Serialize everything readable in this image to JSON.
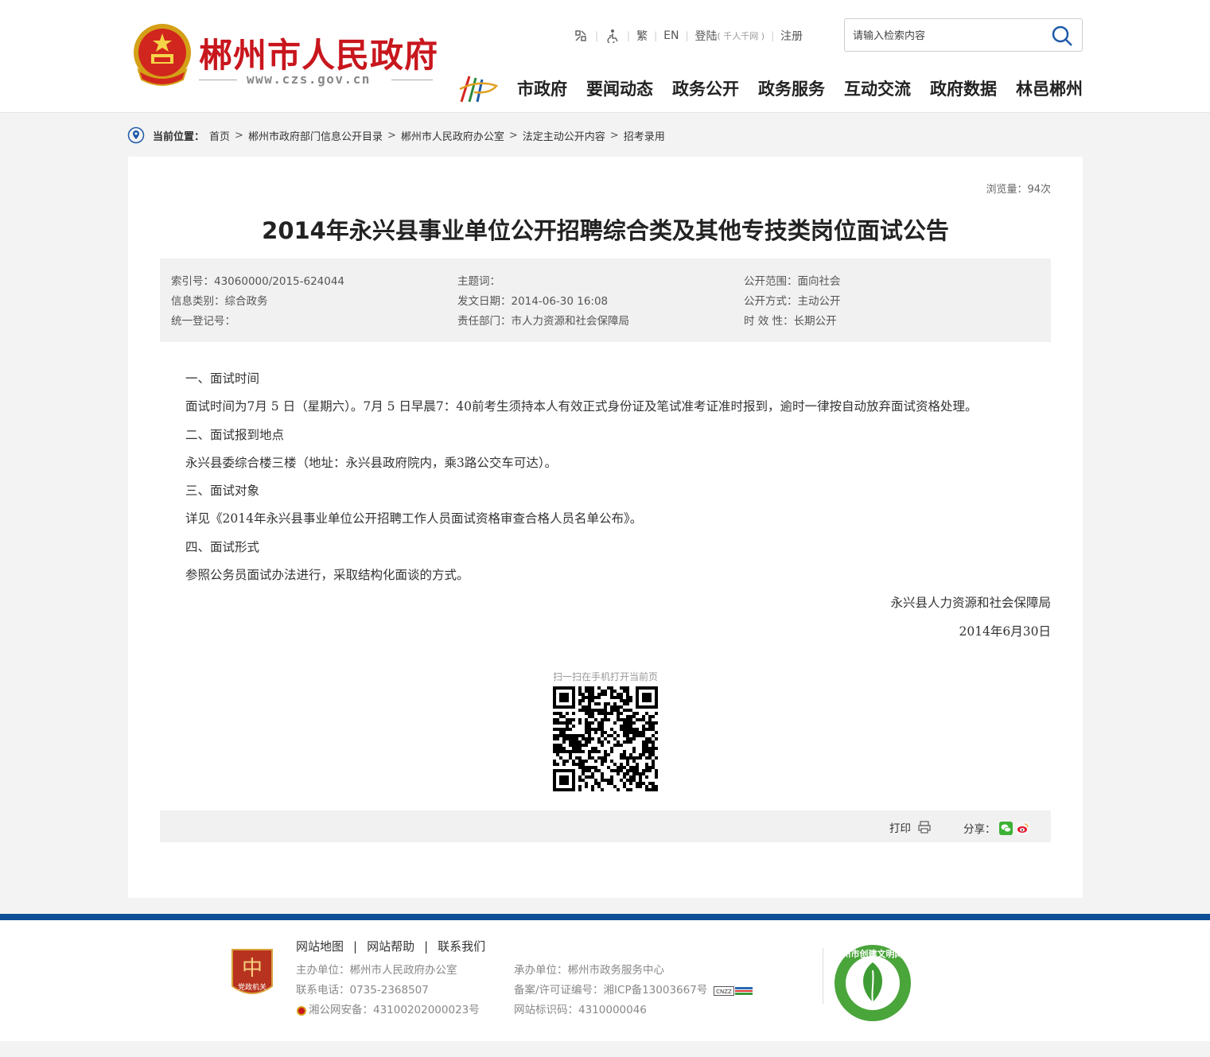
{
  "header": {
    "site_name": "郴州市人民政府",
    "site_url": "www.czs.gov.cn",
    "toplinks": {
      "traditional": "繁",
      "english": "EN",
      "login": "登陆",
      "login_note": "( 千人千网 )",
      "register": "注册"
    },
    "search_placeholder": "请输入检索内容",
    "nav": [
      "市政府",
      "要闻动态",
      "政务公开",
      "政务服务",
      "互动交流",
      "政府数据",
      "林邑郴州"
    ]
  },
  "breadcrumb": {
    "label": "当前位置：",
    "items": [
      "首页",
      "郴州市政府部门信息公开目录",
      "郴州市人民政府办公室",
      "法定主动公开内容",
      "招考录用"
    ]
  },
  "article": {
    "views": "浏览量：94次",
    "title": "2014年永兴县事业单位公开招聘综合类及其他专技类岗位面试公告",
    "meta": {
      "index_no": "索引号：43060000/2015-624044",
      "category": "信息类别：综合政务",
      "reg_no": "统一登记号：",
      "subject": "主题词：",
      "date": "发文日期：2014-06-30 16:08",
      "department": "责任部门：市人力资源和社会保障局",
      "scope": "公开范围：面向社会",
      "method": "公开方式：主动公开",
      "validity": "时 效 性：长期公开"
    },
    "paragraphs": [
      "一、面试时间",
      "面试时间为7月 5 日（星期六）。7月 5 日早晨7：40前考生须持本人有效正式身份证及笔试准考证准时报到，逾时一律按自动放弃面试资格处理。",
      "二、面试报到地点",
      "永兴县委综合楼三楼（地址：永兴县政府院内，乘3路公交车可达）。",
      "三、面试对象",
      "详见《2014年永兴县事业单位公开招聘工作人员面试资格审查合格人员名单公布》。",
      "四、面试形式",
      "参照公务员面试办法进行，采取结构化面谈的方式。"
    ],
    "signature": "永兴县人力资源和社会保障局",
    "sign_date": "2014年6月30日",
    "qr_label": "扫一扫在手机打开当前页",
    "print_label": "打印",
    "share_label": "分享："
  },
  "footer": {
    "links": [
      "网站地图",
      "网站帮助",
      "联系我们"
    ],
    "sponsor": "主办单位：郴州市人民政府办公室",
    "phone": "联系电话：0735-2368507",
    "police": "湘公网安备：43100202000023号",
    "operator": "承办单位：郴州市政务服务中心",
    "icp": "备案/许可证编号：湘ICP备13003667号",
    "site_id": "网站标识码：4310000046",
    "badge_text": "党政机关",
    "civil_badge_text": "郴州市创建文明网站"
  },
  "colors": {
    "brand_red": "#c8161d",
    "footer_blue": "#0e4e96",
    "meta_bg": "#f1f1f1"
  }
}
